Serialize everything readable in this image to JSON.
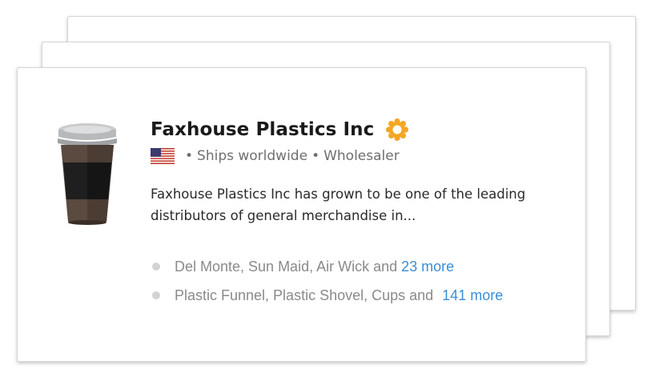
{
  "company": {
    "name": "Faxhouse Plastics Inc",
    "verified_icon": "verified-badge-icon",
    "flag_icon": "us-flag-icon",
    "separator": "•",
    "shipping": "Ships worldwide",
    "type": "Wholesaler",
    "description": "Faxhouse Plastics Inc has grown to be one of the leading distributors of general merchandise in...",
    "image_icon": "coffee-cup-icon"
  },
  "lists": [
    {
      "text": "Del Monte, Sun Maid, Air Wick and",
      "more": "23 more"
    },
    {
      "text": "Plastic Funnel, Plastic Shovel, Cups and",
      "more": "141 more"
    }
  ],
  "colors": {
    "accent": "#3b8fd6",
    "badge": "#f5a623",
    "text_dark": "#1a1a1a",
    "text_muted": "#8a8a8a"
  }
}
